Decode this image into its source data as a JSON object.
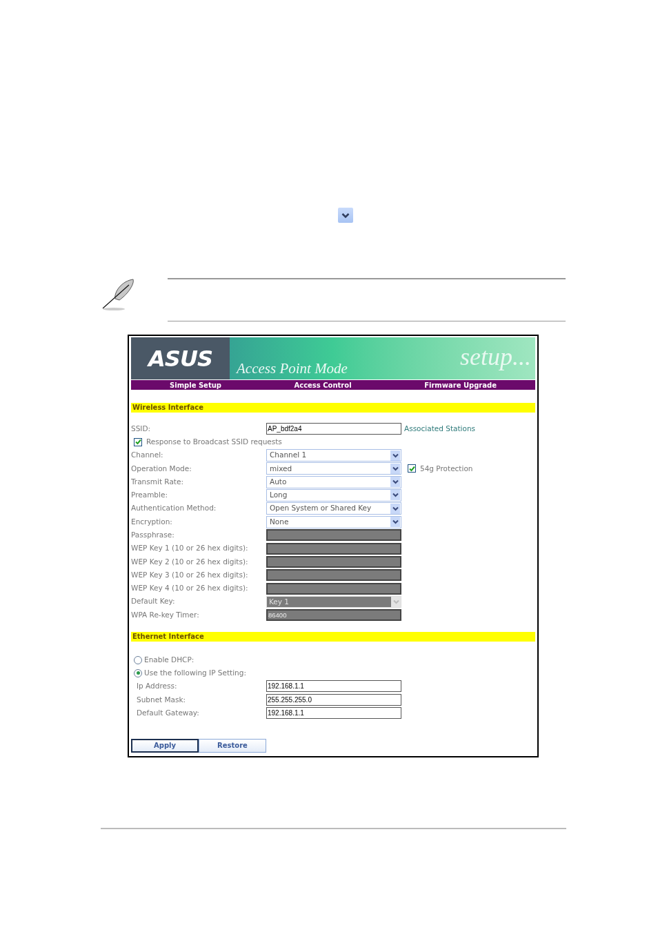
{
  "router_page": {
    "logo": "ASUS",
    "mode_title": "Access Point Mode",
    "banner_word": "setup...",
    "nav": [
      {
        "label": "Simple Setup"
      },
      {
        "label": "Access Control"
      },
      {
        "label": "Firmware Upgrade"
      }
    ],
    "wireless": {
      "title": "Wireless Interface",
      "rows": [
        {
          "kind": "text",
          "label": "SSID:",
          "value": "AP_bdf2a4",
          "link": "Associated Stations"
        },
        {
          "kind": "checkbox",
          "label": "Response to Broadcast SSID requests",
          "checked": true
        },
        {
          "kind": "select",
          "label": "Channel:",
          "value": "Channel 1"
        },
        {
          "kind": "select",
          "label": "Operation Mode:",
          "value": "mixed",
          "option": {
            "label": "54g Protection",
            "checked": true
          }
        },
        {
          "kind": "select",
          "label": "Transmit Rate:",
          "value": "Auto"
        },
        {
          "kind": "select",
          "label": "Preamble:",
          "value": "Long"
        },
        {
          "kind": "select",
          "label": "Authentication Method:",
          "value": "Open System or Shared Key"
        },
        {
          "kind": "select",
          "label": "Encryption:",
          "value": "None"
        },
        {
          "kind": "input_disabled",
          "label": "Passphrase:"
        },
        {
          "kind": "input_disabled",
          "label": "WEP Key 1 (10 or 26 hex digits):"
        },
        {
          "kind": "input_disabled",
          "label": "WEP Key 2 (10 or 26 hex digits):"
        },
        {
          "kind": "input_disabled",
          "label": "WEP Key 3 (10 or 26 hex digits):"
        },
        {
          "kind": "input_disabled",
          "label": "WEP Key 4 (10 or 26 hex digits):"
        },
        {
          "kind": "select_disabled",
          "label": "Default Key:",
          "value": "Key 1"
        },
        {
          "kind": "input_disabled",
          "label": "WPA Re-key Timer:",
          "value": "86400"
        }
      ]
    },
    "ethernet": {
      "title": "Ethernet Interface",
      "radios": [
        {
          "label": "Enable DHCP:",
          "selected": false
        },
        {
          "label": "Use the following IP Setting:",
          "selected": true
        }
      ],
      "fields": [
        {
          "label": "Ip Address:",
          "value": "192.168.1.1"
        },
        {
          "label": "Subnet Mask:",
          "value": "255.255.255.0"
        },
        {
          "label": "Default Gateway:",
          "value": "192.168.1.1"
        }
      ]
    },
    "buttons": [
      {
        "label": "Apply",
        "focused": true
      },
      {
        "label": "Restore",
        "focused": false
      }
    ]
  }
}
